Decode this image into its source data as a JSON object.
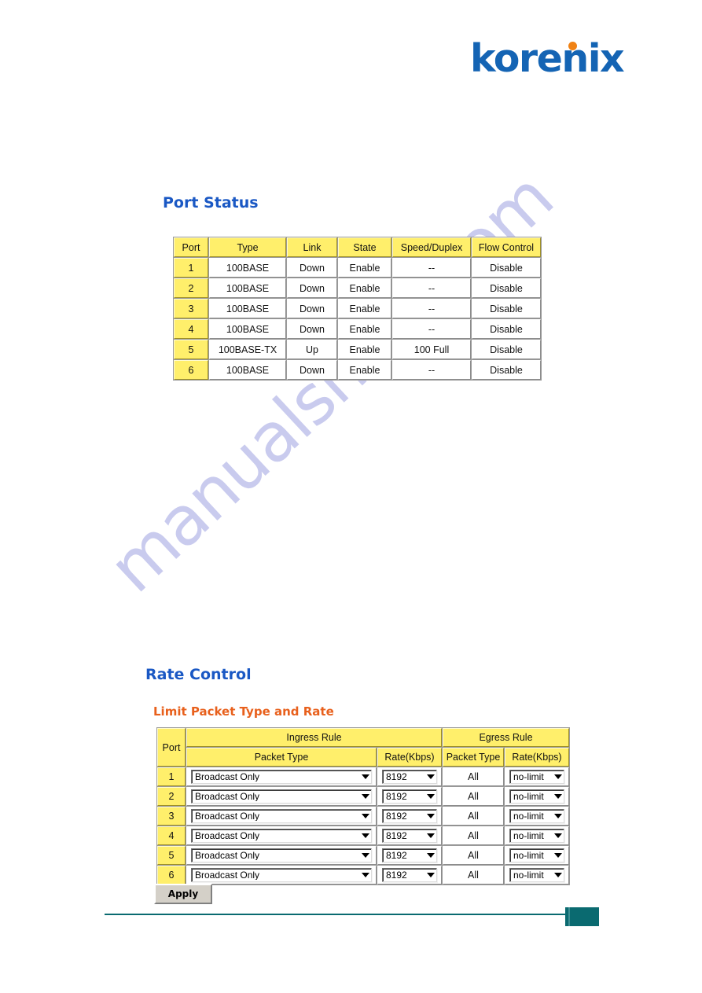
{
  "brand": {
    "logo_text": "korenix",
    "logo_blue": "#1464b4",
    "logo_dot_color": "#f08214"
  },
  "port_status": {
    "title": "Port Status",
    "columns": [
      "Port",
      "Type",
      "Link",
      "State",
      "Speed/Duplex",
      "Flow Control"
    ],
    "rows": [
      {
        "port": "1",
        "type": "100BASE",
        "link": "Down",
        "state": "Enable",
        "speed_duplex": "--",
        "flow_control": "Disable"
      },
      {
        "port": "2",
        "type": "100BASE",
        "link": "Down",
        "state": "Enable",
        "speed_duplex": "--",
        "flow_control": "Disable"
      },
      {
        "port": "3",
        "type": "100BASE",
        "link": "Down",
        "state": "Enable",
        "speed_duplex": "--",
        "flow_control": "Disable"
      },
      {
        "port": "4",
        "type": "100BASE",
        "link": "Down",
        "state": "Enable",
        "speed_duplex": "--",
        "flow_control": "Disable"
      },
      {
        "port": "5",
        "type": "100BASE-TX",
        "link": "Up",
        "state": "Enable",
        "speed_duplex": "100 Full",
        "flow_control": "Disable"
      },
      {
        "port": "6",
        "type": "100BASE",
        "link": "Down",
        "state": "Enable",
        "speed_duplex": "--",
        "flow_control": "Disable"
      }
    ]
  },
  "rate_control": {
    "title": "Rate Control",
    "subtitle": "Limit Packet Type and Rate",
    "group_headers": {
      "port": "Port",
      "ingress": "Ingress Rule",
      "egress": "Egress Rule"
    },
    "sub_headers": {
      "ingress_packet_type": "Packet Type",
      "ingress_rate": "Rate(Kbps)",
      "egress_packet_type": "Packet Type",
      "egress_rate": "Rate(Kbps)"
    },
    "rows": [
      {
        "port": "1",
        "ingress_packet_type": "Broadcast Only",
        "ingress_rate": "8192",
        "egress_packet_type": "All",
        "egress_rate": "no-limit"
      },
      {
        "port": "2",
        "ingress_packet_type": "Broadcast Only",
        "ingress_rate": "8192",
        "egress_packet_type": "All",
        "egress_rate": "no-limit"
      },
      {
        "port": "3",
        "ingress_packet_type": "Broadcast Only",
        "ingress_rate": "8192",
        "egress_packet_type": "All",
        "egress_rate": "no-limit"
      },
      {
        "port": "4",
        "ingress_packet_type": "Broadcast Only",
        "ingress_rate": "8192",
        "egress_packet_type": "All",
        "egress_rate": "no-limit"
      },
      {
        "port": "5",
        "ingress_packet_type": "Broadcast Only",
        "ingress_rate": "8192",
        "egress_packet_type": "All",
        "egress_rate": "no-limit"
      },
      {
        "port": "6",
        "ingress_packet_type": "Broadcast Only",
        "ingress_rate": "8192",
        "egress_packet_type": "All",
        "egress_rate": "no-limit"
      }
    ],
    "apply_label": "Apply"
  },
  "watermark": {
    "text": "manualshive.com",
    "color": "#c9cbee"
  },
  "footer": {
    "accent_color": "#0a6a70"
  }
}
